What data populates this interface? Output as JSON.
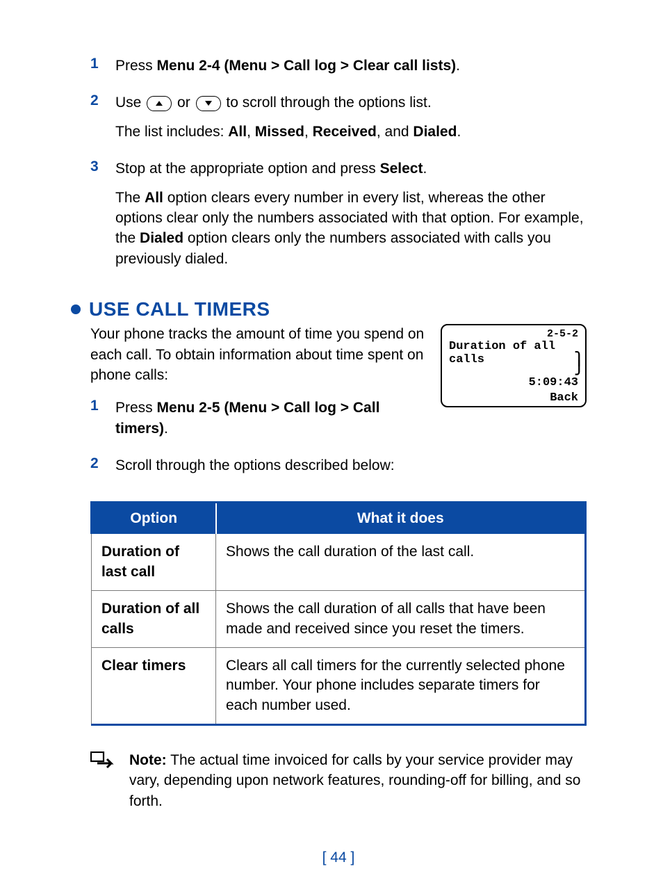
{
  "steps_a": [
    {
      "num": "1",
      "prefix": "Press ",
      "bold": "Menu 2-4 (Menu > Call log > Clear call lists)",
      "suffix": "."
    },
    {
      "num": "2",
      "line_pre": "Use ",
      "line_mid": " or ",
      "line_post": " to scroll through the options list.",
      "sub_prefix": "The list includes: ",
      "sub_bold_items": [
        "All",
        "Missed",
        "Received",
        "Dialed"
      ],
      "sub_join": ", ",
      "sub_last_join": ", and ",
      "sub_suffix": "."
    },
    {
      "num": "3",
      "prefix": "Stop at the appropriate option and press ",
      "bold": "Select",
      "suffix": ".",
      "para2_pre": "The ",
      "para2_b1": "All",
      "para2_mid": " option clears every number in every list, whereas the other options clear only the numbers associated with that option. For example, the ",
      "para2_b2": "Dialed",
      "para2_post": " option clears only the numbers associated with calls you previously dialed."
    }
  ],
  "section": {
    "title": "USE CALL TIMERS",
    "intro": "Your phone tracks the amount of time you spend on each call. To obtain information about time spent on phone calls:"
  },
  "phone": {
    "breadcrumb": "2-5-2",
    "title_line1": "Duration of all",
    "title_line2": "calls",
    "time": "5:09:43",
    "back": "Back"
  },
  "steps_b": [
    {
      "num": "1",
      "prefix": "Press ",
      "bold": "Menu 2-5 (Menu > Call log > Call timers)",
      "suffix": "."
    },
    {
      "num": "2",
      "prefix": "Scroll through the options described below:",
      "bold": "",
      "suffix": ""
    }
  ],
  "table": {
    "headers": [
      "Option",
      "What it does"
    ],
    "rows": [
      {
        "option": "Duration of last call",
        "desc": "Shows the call duration of the last call."
      },
      {
        "option": "Duration of all calls",
        "desc": "Shows the call duration of all calls that have been made and received since you reset the timers."
      },
      {
        "option": "Clear timers",
        "desc": "Clears all call timers for the currently selected phone number. Your phone includes separate timers for each number used."
      }
    ]
  },
  "note": {
    "label": "Note:",
    "text": "  The actual time invoiced for calls by your service provider may vary, depending upon network features, rounding-off for billing, and so forth."
  },
  "footer": "[ 44 ]"
}
